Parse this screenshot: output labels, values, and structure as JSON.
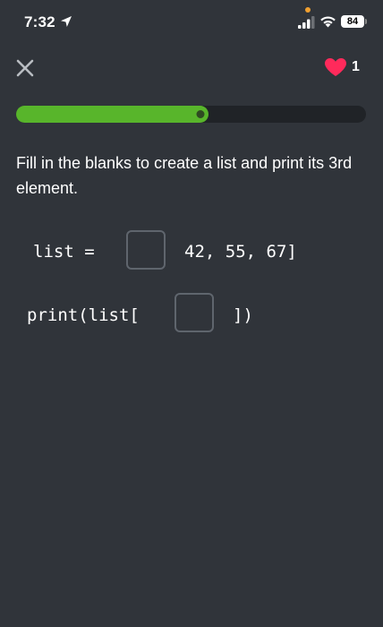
{
  "status_bar": {
    "time": "7:32",
    "battery": "84"
  },
  "header": {
    "hearts": "1",
    "progress_fraction": 0.55,
    "progress_color": "#58b52b",
    "heart_color": "#ff2a5b"
  },
  "question": {
    "instruction": "Fill in the blanks to create a list and print its 3rd element.",
    "line1_prefix": "list =",
    "line1_suffix": "42, 55, 67]",
    "line2_prefix": "print(list[",
    "line2_suffix": "])"
  }
}
